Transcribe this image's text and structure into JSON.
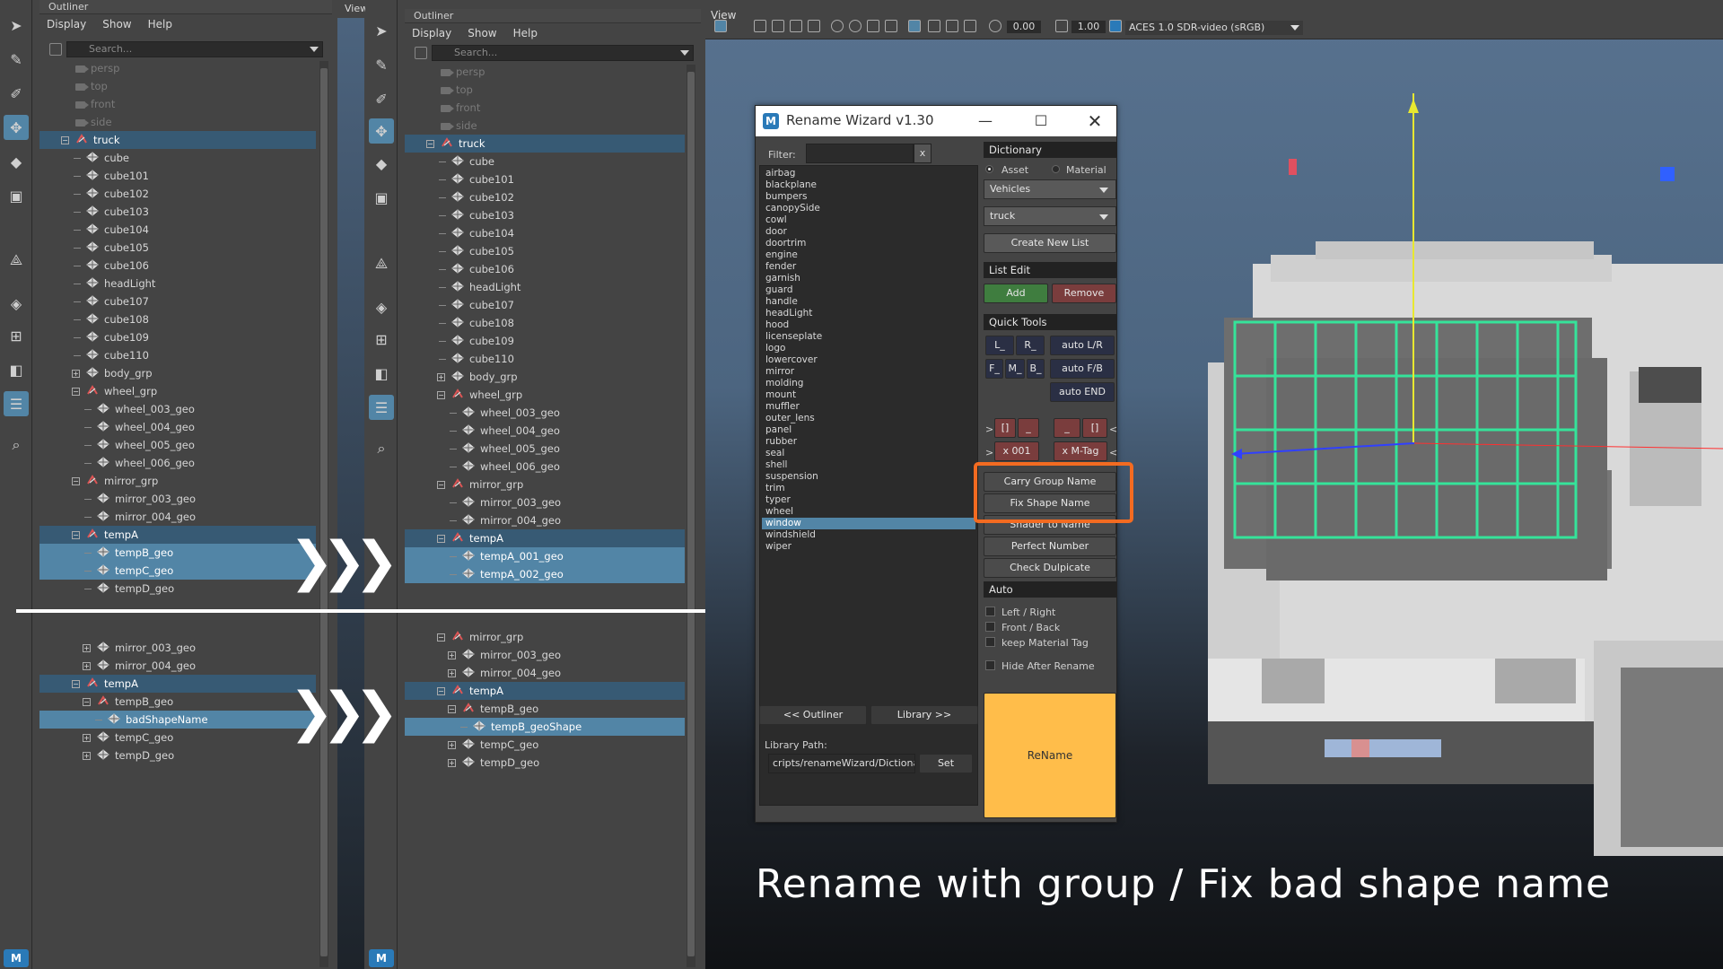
{
  "left_outliner": {
    "title": "Outliner",
    "menu": [
      "Display",
      "Show",
      "Help"
    ],
    "search_placeholder": "Search...",
    "top_nodes": [
      {
        "label": "persp",
        "kind": "cam",
        "dim": true,
        "indent": 1
      },
      {
        "label": "top",
        "kind": "cam",
        "dim": true,
        "indent": 1
      },
      {
        "label": "front",
        "kind": "cam",
        "dim": true,
        "indent": 1
      },
      {
        "label": "side",
        "kind": "cam",
        "dim": true,
        "indent": 1
      },
      {
        "label": "truck",
        "kind": "grp",
        "indent": 1,
        "sel": "row",
        "exp": "minus"
      },
      {
        "label": "cube",
        "kind": "mesh",
        "indent": 2
      },
      {
        "label": "cube101",
        "kind": "mesh",
        "indent": 2
      },
      {
        "label": "cube102",
        "kind": "mesh",
        "indent": 2
      },
      {
        "label": "cube103",
        "kind": "mesh",
        "indent": 2
      },
      {
        "label": "cube104",
        "kind": "mesh",
        "indent": 2
      },
      {
        "label": "cube105",
        "kind": "mesh",
        "indent": 2
      },
      {
        "label": "cube106",
        "kind": "mesh",
        "indent": 2
      },
      {
        "label": "headLight",
        "kind": "mesh",
        "indent": 2
      },
      {
        "label": "cube107",
        "kind": "mesh",
        "indent": 2
      },
      {
        "label": "cube108",
        "kind": "mesh",
        "indent": 2
      },
      {
        "label": "cube109",
        "kind": "mesh",
        "indent": 2
      },
      {
        "label": "cube110",
        "kind": "mesh",
        "indent": 2
      },
      {
        "label": "body_grp",
        "kind": "mesh",
        "indent": 2,
        "exp": "plus"
      },
      {
        "label": "wheel_grp",
        "kind": "grp",
        "indent": 2,
        "exp": "minus"
      },
      {
        "label": "wheel_003_geo",
        "kind": "mesh",
        "indent": 3
      },
      {
        "label": "wheel_004_geo",
        "kind": "mesh",
        "indent": 3
      },
      {
        "label": "wheel_005_geo",
        "kind": "mesh",
        "indent": 3
      },
      {
        "label": "wheel_006_geo",
        "kind": "mesh",
        "indent": 3
      },
      {
        "label": "mirror_grp",
        "kind": "grp",
        "indent": 2,
        "exp": "minus"
      },
      {
        "label": "mirror_003_geo",
        "kind": "mesh",
        "indent": 3
      },
      {
        "label": "mirror_004_geo",
        "kind": "mesh",
        "indent": 3
      },
      {
        "label": "tempA",
        "kind": "grp",
        "indent": 2,
        "exp": "minus",
        "sel": "row"
      },
      {
        "label": "tempB_geo",
        "kind": "mesh",
        "indent": 3,
        "sel": "full"
      },
      {
        "label": "tempC_geo",
        "kind": "mesh",
        "indent": 3,
        "sel": "full"
      },
      {
        "label": "tempD_geo",
        "kind": "mesh",
        "indent": 3
      }
    ],
    "bottom_nodes": [
      {
        "label": "mirror_003_geo",
        "kind": "mesh",
        "indent": 3,
        "exp": "plus"
      },
      {
        "label": "mirror_004_geo",
        "kind": "mesh",
        "indent": 3,
        "exp": "plus"
      },
      {
        "label": "tempA",
        "kind": "grp",
        "indent": 2,
        "exp": "minus",
        "sel": "row"
      },
      {
        "label": "tempB_geo",
        "kind": "grp",
        "indent": 3,
        "exp": "minus"
      },
      {
        "label": "badShapeName",
        "kind": "mesh",
        "indent": 4,
        "sel": "full"
      },
      {
        "label": "tempC_geo",
        "kind": "mesh",
        "indent": 3,
        "exp": "plus"
      },
      {
        "label": "tempD_geo",
        "kind": "mesh",
        "indent": 3,
        "exp": "plus"
      }
    ]
  },
  "right_outliner": {
    "view_tab": "View",
    "title": "Outliner",
    "menu": [
      "Display",
      "Show",
      "Help"
    ],
    "search_placeholder": "Search...",
    "top_nodes": [
      {
        "label": "persp",
        "kind": "cam",
        "dim": true,
        "indent": 1
      },
      {
        "label": "top",
        "kind": "cam",
        "dim": true,
        "indent": 1
      },
      {
        "label": "front",
        "kind": "cam",
        "dim": true,
        "indent": 1
      },
      {
        "label": "side",
        "kind": "cam",
        "dim": true,
        "indent": 1
      },
      {
        "label": "truck",
        "kind": "grp",
        "indent": 1,
        "sel": "row",
        "exp": "minus"
      },
      {
        "label": "cube",
        "kind": "mesh",
        "indent": 2
      },
      {
        "label": "cube101",
        "kind": "mesh",
        "indent": 2
      },
      {
        "label": "cube102",
        "kind": "mesh",
        "indent": 2
      },
      {
        "label": "cube103",
        "kind": "mesh",
        "indent": 2
      },
      {
        "label": "cube104",
        "kind": "mesh",
        "indent": 2
      },
      {
        "label": "cube105",
        "kind": "mesh",
        "indent": 2
      },
      {
        "label": "cube106",
        "kind": "mesh",
        "indent": 2
      },
      {
        "label": "headLight",
        "kind": "mesh",
        "indent": 2
      },
      {
        "label": "cube107",
        "kind": "mesh",
        "indent": 2
      },
      {
        "label": "cube108",
        "kind": "mesh",
        "indent": 2
      },
      {
        "label": "cube109",
        "kind": "mesh",
        "indent": 2
      },
      {
        "label": "cube110",
        "kind": "mesh",
        "indent": 2
      },
      {
        "label": "body_grp",
        "kind": "mesh",
        "indent": 2,
        "exp": "plus"
      },
      {
        "label": "wheel_grp",
        "kind": "grp",
        "indent": 2,
        "exp": "minus"
      },
      {
        "label": "wheel_003_geo",
        "kind": "mesh",
        "indent": 3
      },
      {
        "label": "wheel_004_geo",
        "kind": "mesh",
        "indent": 3
      },
      {
        "label": "wheel_005_geo",
        "kind": "mesh",
        "indent": 3
      },
      {
        "label": "wheel_006_geo",
        "kind": "mesh",
        "indent": 3
      },
      {
        "label": "mirror_grp",
        "kind": "grp",
        "indent": 2,
        "exp": "minus"
      },
      {
        "label": "mirror_003_geo",
        "kind": "mesh",
        "indent": 3
      },
      {
        "label": "mirror_004_geo",
        "kind": "mesh",
        "indent": 3
      },
      {
        "label": "tempA",
        "kind": "grp",
        "indent": 2,
        "exp": "minus",
        "sel": "row"
      },
      {
        "label": "tempA_001_geo",
        "kind": "mesh",
        "indent": 3,
        "sel": "full"
      },
      {
        "label": "tempA_002_geo",
        "kind": "mesh",
        "indent": 3,
        "sel": "full"
      }
    ],
    "bottom_nodes": [
      {
        "label": "mirror_grp",
        "kind": "grp",
        "indent": 2,
        "exp": "minus"
      },
      {
        "label": "mirror_003_geo",
        "kind": "mesh",
        "indent": 3,
        "exp": "plus"
      },
      {
        "label": "mirror_004_geo",
        "kind": "mesh",
        "indent": 3,
        "exp": "plus"
      },
      {
        "label": "tempA",
        "kind": "grp",
        "indent": 2,
        "exp": "minus",
        "sel": "row"
      },
      {
        "label": "tempB_geo",
        "kind": "grp",
        "indent": 3,
        "exp": "minus"
      },
      {
        "label": "tempB_geoShape",
        "kind": "mesh",
        "indent": 4,
        "sel": "full"
      },
      {
        "label": "tempC_geo",
        "kind": "mesh",
        "indent": 3,
        "exp": "plus"
      },
      {
        "label": "tempD_geo",
        "kind": "mesh",
        "indent": 3,
        "exp": "plus"
      }
    ]
  },
  "left_view_tab": "View",
  "viewport": {
    "view_tab": "View",
    "field1": "0.00",
    "field2": "1.00",
    "color_space": "ACES 1.0 SDR-video (sRGB)"
  },
  "rename_wizard": {
    "title": "Rename Wizard v1.30",
    "logo": "M",
    "filter_label": "Filter:",
    "filter_clear": "x",
    "dictionary_items": [
      "airbag",
      "blackplane",
      "bumpers",
      "canopySide",
      "cowl",
      "door",
      "doortrim",
      "engine",
      "fender",
      "garnish",
      "guard",
      "handle",
      "headLight",
      "hood",
      "licenseplate",
      "logo",
      "lowercover",
      "mirror",
      "molding",
      "mount",
      "muffler",
      "outer_lens",
      "panel",
      "rubber",
      "seal",
      "shell",
      "suspension",
      "trim",
      "typer",
      "wheel",
      "window",
      "windshield",
      "wiper"
    ],
    "selected_item": "window",
    "dictionary_header": "Dictionary",
    "radio_asset": "Asset",
    "radio_material": "Material",
    "dropdown_category": "Vehicles",
    "dropdown_list": "truck",
    "create_new_list": "Create New List",
    "list_edit_header": "List Edit",
    "add": "Add",
    "remove": "Remove",
    "quick_tools_header": "Quick Tools",
    "btn_L": "L_",
    "btn_R": "R_",
    "btn_F": "F_",
    "btn_M": "M_",
    "btn_B": "B_",
    "auto_lr": "auto L/R",
    "auto_fb": "auto F/B",
    "auto_end": "auto END",
    "bracket_left": "[]",
    "underscore_left": "_",
    "underscore_right": "_",
    "bracket_right": "[]",
    "arrow_right_1": ">",
    "arrow_left_1": "<",
    "arrow_right_2": ">",
    "arrow_left_2": "<",
    "x001": "x 001",
    "xmtag": "x M-Tag",
    "carry_group_name": "Carry Group Name",
    "fix_shape_name": "Fix Shape Name",
    "shader_to_name": "Shader to Name",
    "perfect_number": "Perfect Number",
    "check_duplicate": "Check Dulpicate",
    "auto_header": "Auto",
    "chk_left_right": "Left / Right",
    "chk_front_back": "Front / Back",
    "chk_keep_material": "keep Material Tag",
    "chk_hide_after": "Hide After Rename",
    "outliner_btn": "<< Outliner",
    "library_btn": "Library >>",
    "library_path_label": "Library Path:",
    "library_path_value": "cripts/renameWizard/Dictionary",
    "set_btn": "Set",
    "rename_btn": "ReName",
    "rename_color": "#ffbd4a"
  },
  "caption": "Rename with group / Fix bad shape name",
  "accent_highlight": "#f36b21",
  "selection_color": "#5285a6",
  "mesh_highlight": "#35e39a"
}
